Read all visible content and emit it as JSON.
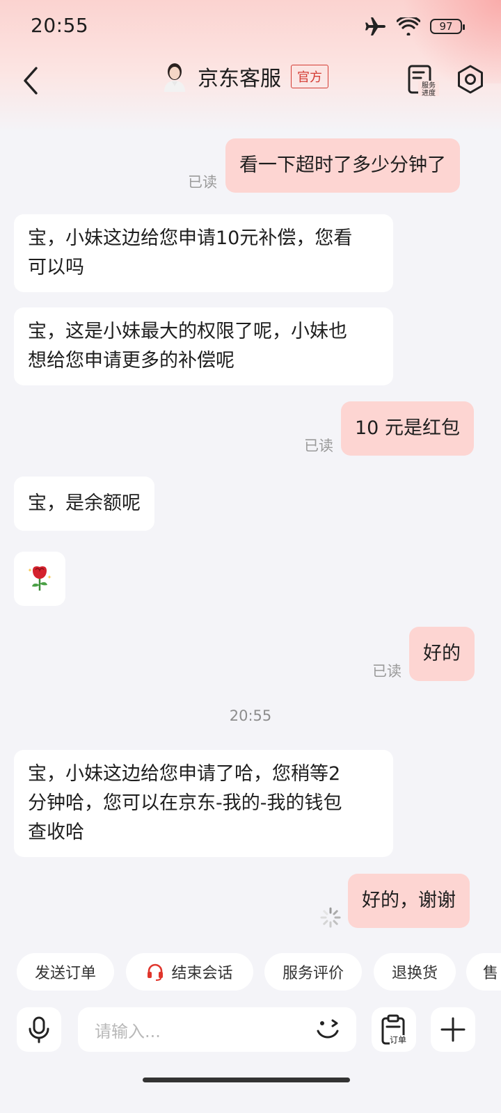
{
  "status_bar": {
    "time": "20:55",
    "battery": "97"
  },
  "header": {
    "title": "京东客服",
    "badge": "官方",
    "service_progress_label": "服务进度"
  },
  "messages": [
    {
      "side": "right",
      "text": "看一下超时了多少分钟了",
      "read": "已读"
    },
    {
      "side": "left",
      "lines": [
        "宝，小妹这边给您申请10元补偿，您看",
        "可以吗"
      ]
    },
    {
      "side": "left",
      "lines": [
        "宝，这是小妹最大的权限了呢，小妹也",
        "想给您申请更多的补偿呢"
      ]
    },
    {
      "side": "right",
      "text": "10 元是红包",
      "read": "已读"
    },
    {
      "side": "left",
      "text": "宝，是余额呢"
    },
    {
      "side": "left",
      "emoji": "rose"
    },
    {
      "side": "right",
      "text": "好的",
      "read": "已读"
    },
    {
      "timestamp": "20:55"
    },
    {
      "side": "left",
      "lines": [
        "宝，小妹这边给您申请了哈，您稍等2",
        "分钟哈，您可以在京东-我的-我的钱包",
        "查收哈"
      ]
    },
    {
      "side": "right",
      "text": "好的，谢谢",
      "status": "sending"
    }
  ],
  "quick_actions": [
    "发送订单",
    "结束会话",
    "服务评价",
    "退换货",
    "售"
  ],
  "input": {
    "placeholder": "请输入...",
    "order_label": "订单"
  },
  "colors": {
    "bubble_right": "#fdd5d2",
    "bubble_left": "#ffffff",
    "accent": "#d43c33",
    "background": "#f4f4f8"
  }
}
